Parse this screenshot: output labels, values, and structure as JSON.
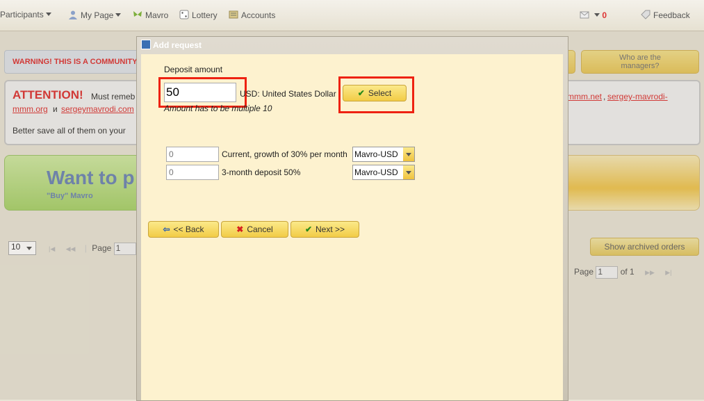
{
  "nav": {
    "participants": "Participants",
    "my_page": "My Page",
    "mavro": "Mavro",
    "lottery": "Lottery",
    "accounts": "Accounts",
    "messages_count": "0",
    "feedback": "Feedback"
  },
  "background": {
    "warning": "WARNING! THIS IS A COMMUNITY C",
    "managers_line1": "Who are the",
    "managers_line2": "managers?",
    "attention_title": "ATTENTION!",
    "attention_text1": "Must remeb",
    "link_mmm_net": "mmm.net",
    "link_mavrodi_mmm_a": "sergey-mavrodi-",
    "link_mavrodi_mmm_b": "mmm.org",
    "and": "и",
    "link_sergeymavrodi": "sergeymavrodi.com",
    "better_save": "Better save all of them on your",
    "want_to": "Want to p",
    "buy_mavro": "\"Buy\" Mavro",
    "page_size": "10",
    "page_label": "Page",
    "page_value": "1",
    "page_label_right": "Page",
    "page_value_right": "1",
    "of_label": "of 1",
    "show_archived": "Show archived orders"
  },
  "dialog": {
    "title": "Add request",
    "deposit_label": "Deposit amount",
    "deposit_value": "50",
    "currency": "USD: United States Dollar",
    "select_label": "Select",
    "hint": "Amount has to be multiple 10",
    "row1_value": "0",
    "row1_label": "Current, growth of 30% per month",
    "row1_currency": "Mavro-USD",
    "row2_value": "0",
    "row2_label": "3-month deposit 50%",
    "row2_currency": "Mavro-USD",
    "back_label": "<< Back",
    "cancel_label": "Cancel",
    "next_label": "Next >>"
  }
}
